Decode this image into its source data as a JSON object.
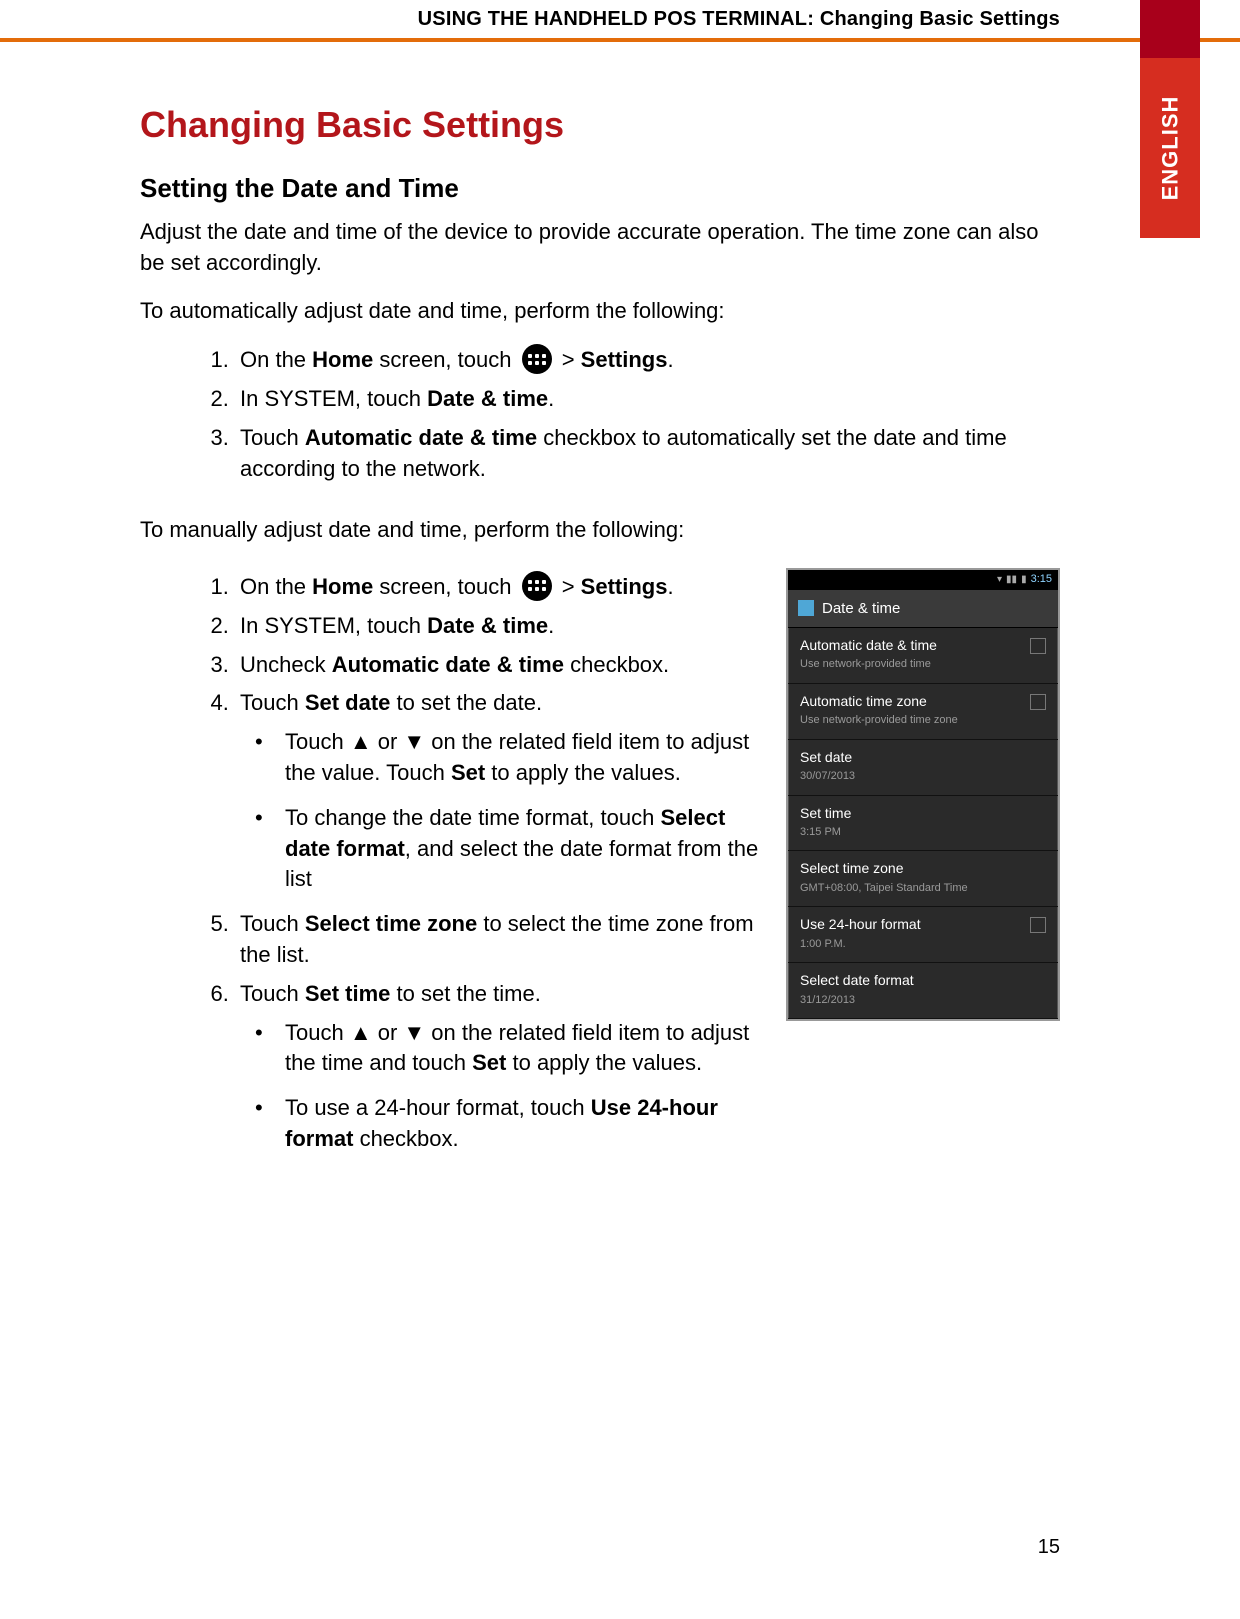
{
  "header": {
    "breadcrumb": "USING THE HANDHELD POS TERMINAL: Changing Basic Settings",
    "language_tab": "ENGLISH"
  },
  "page_number": "15",
  "title": "Changing Basic Settings",
  "section_heading": "Setting the Date and Time",
  "intro_para": "Adjust the date and time of the device to provide accurate operation. The time zone can also be set accordingly.",
  "auto_intro": "To automatically adjust date and time, perform the following:",
  "manual_intro": "To manually adjust date and time, perform the following:",
  "icon_names": {
    "apps": "apps-grid-icon"
  },
  "strings": {
    "on_the": "On the ",
    "home": "Home",
    "screen_touch": " screen, touch ",
    "gt": " > ",
    "settings": "Settings",
    "period": ".",
    "in_system_touch": "In SYSTEM, touch ",
    "date_time": "Date & time",
    "touch": "Touch ",
    "auto_dt": "Automatic date & time",
    "auto_dt_tail": " checkbox to automatically set the date and time according to the network.",
    "uncheck": "Uncheck ",
    "checkbox_period": " checkbox.",
    "set_date": "Set date",
    "to_set_date": " to set the date.",
    "up": "▲",
    "down": "▼",
    "or": " or ",
    "sub_adjust_date_pre": "Touch ",
    "sub_adjust_date_mid": " on the related field item to adjust the value. Touch ",
    "set": "Set",
    "sub_adjust_date_tail": " to apply the values.",
    "sub_format_pre": "To change the date time format, touch ",
    "select_date_format": "Select date format",
    "sub_format_tail": ", and select the date format from the list",
    "select_time_zone": "Select time zone",
    "step5_tail": " to select the time zone from the list.",
    "set_time": "Set time",
    "step6_tail": " to set the time.",
    "sub_adjust_time_mid": " on the related field item to adjust the time and touch ",
    "sub_24_pre": "To use a 24-hour format, touch ",
    "use_24": "Use 24-hour format",
    "sub_24_tail": " checkbox."
  },
  "phone": {
    "status_time": "3:15",
    "header": "Date & time",
    "rows": [
      {
        "title": "Automatic date & time",
        "sub": "Use network-provided time",
        "checkbox": true
      },
      {
        "title": "Automatic time zone",
        "sub": "Use network-provided time zone",
        "checkbox": true
      },
      {
        "title": "Set date",
        "sub": "30/07/2013"
      },
      {
        "title": "Set time",
        "sub": "3:15 PM"
      },
      {
        "title": "Select time zone",
        "sub": "GMT+08:00, Taipei Standard Time"
      },
      {
        "title": "Use 24-hour format",
        "sub": "1:00 P.M.",
        "checkbox": true
      },
      {
        "title": "Select date format",
        "sub": "31/12/2013"
      }
    ]
  }
}
